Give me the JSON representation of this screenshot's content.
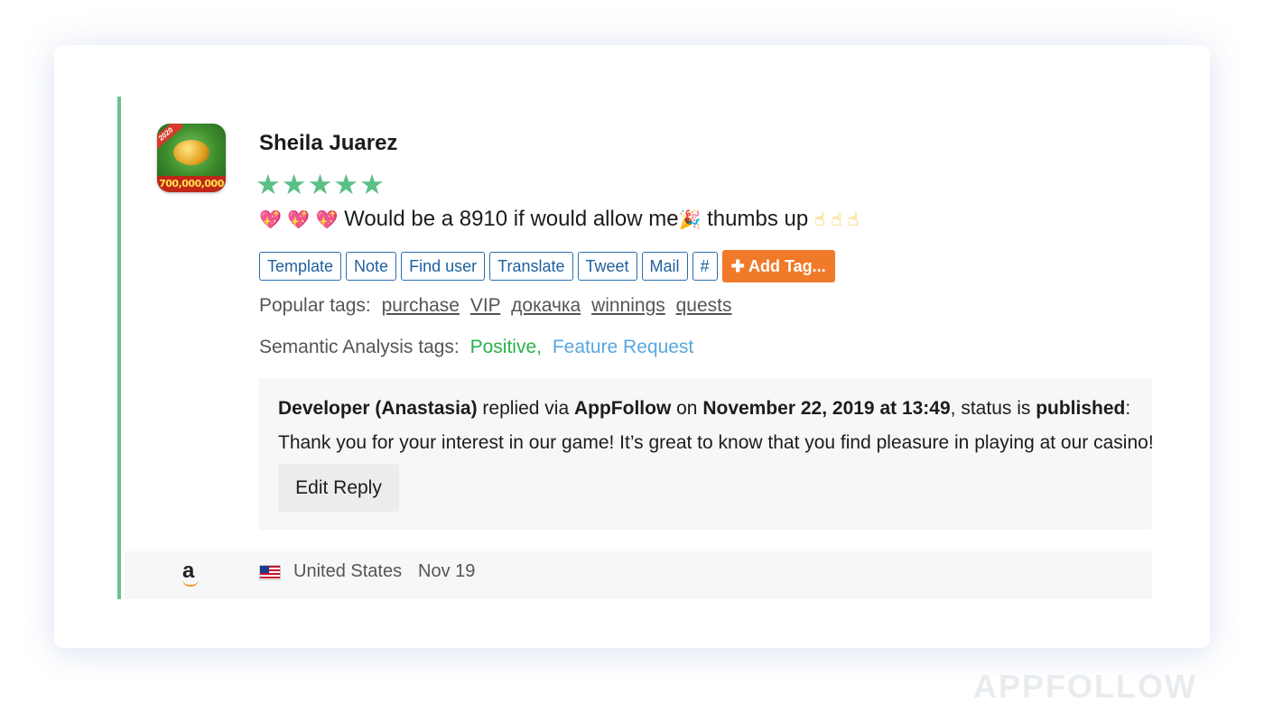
{
  "review": {
    "author": "Sheila Juarez",
    "rating": 5,
    "rating_stars": "★★★★★",
    "text": {
      "hearts": "💖 💖 💖",
      "body": "Would be a 8910 if would allow me",
      "party": "🎉",
      "tail": "thumbs up",
      "hands": "☝ ☝ ☝"
    },
    "app_icon": {
      "ribbon": "2020",
      "banner": "700,000,000"
    }
  },
  "actions": {
    "template": "Template",
    "note": "Note",
    "find_user": "Find user",
    "translate": "Translate",
    "tweet": "Tweet",
    "mail": "Mail",
    "hash": "#",
    "add_tag": "✚ Add Tag..."
  },
  "popular_tags": {
    "label": "Popular tags:",
    "tags": [
      "purchase",
      "VIP",
      "докачка",
      "winnings",
      "quests"
    ]
  },
  "semantic": {
    "label": "Semantic Analysis tags:",
    "positive": "Positive,",
    "feature": "Feature Request"
  },
  "reply": {
    "developer": "Developer (Anastasia)",
    "replied_via": " replied via ",
    "platform": "AppFollow",
    "on": " on ",
    "date": "November 22, 2019 at 13:49",
    "status_prefix": ", status is ",
    "status": "published",
    "colon": ":",
    "text": "Thank you for your interest in our game! It’s great to know that you find pleasure in playing at our casino!",
    "edit_label": "Edit Reply"
  },
  "footer": {
    "store_icon": "amazon-icon",
    "store_letter": "a",
    "country": "United States",
    "date": "Nov 19"
  },
  "watermark": "APPFOLLOW",
  "colors": {
    "accent_green": "#6cc08b",
    "star_green": "#5bbf86",
    "button_blue": "#2a6fb0",
    "add_tag_orange": "#f07a2a",
    "positive_green": "#2bb24c",
    "feature_blue": "#5aa6e0"
  }
}
